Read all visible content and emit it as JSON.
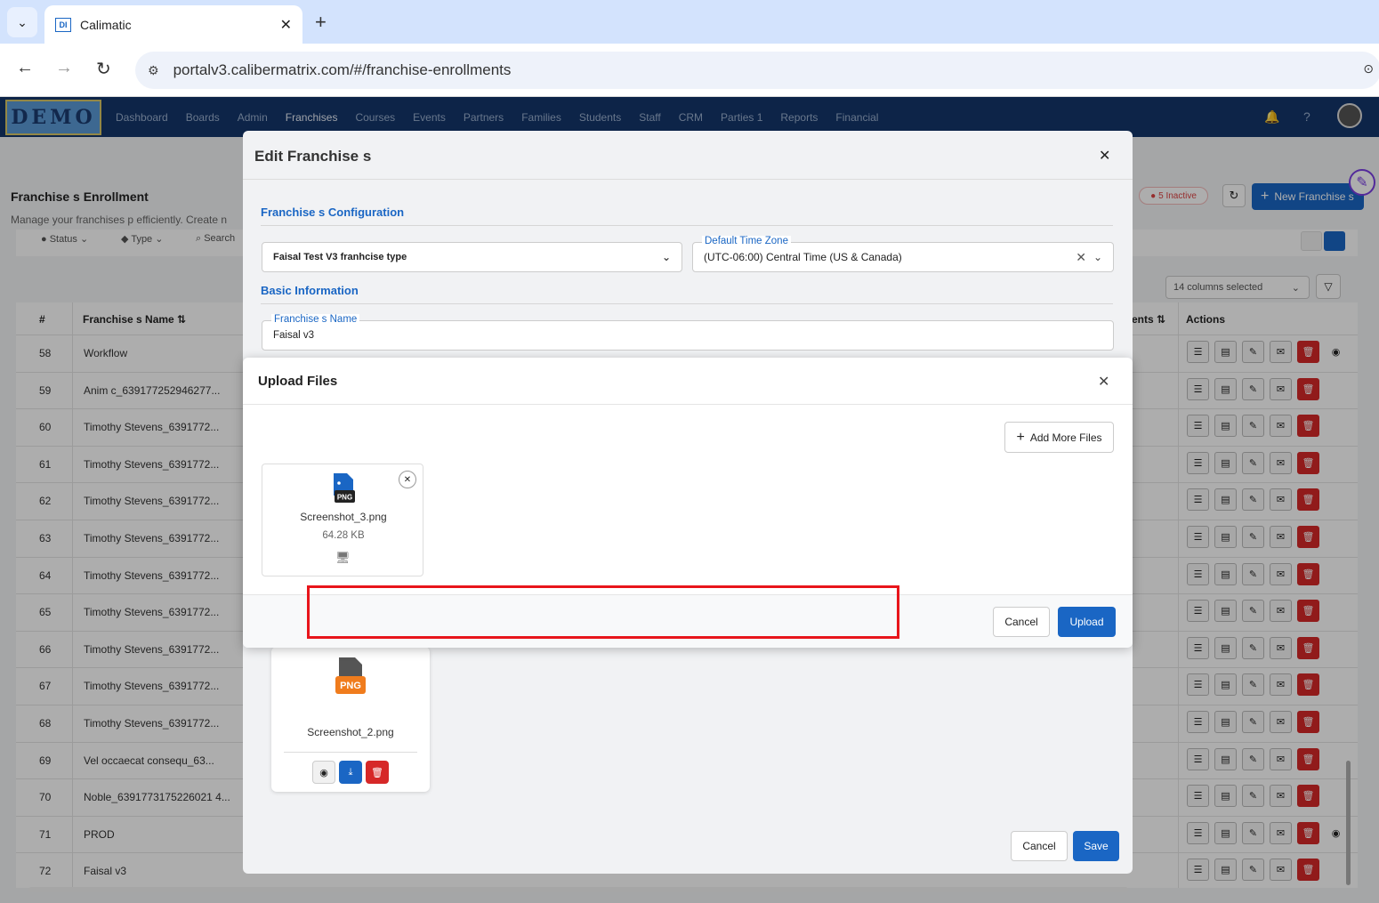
{
  "browser": {
    "tab_title": "Calimatic",
    "url": "portalv3.calibermatrix.com/#/franchise-enrollments"
  },
  "app": {
    "logo": "DEMO",
    "nav": [
      "Dashboard",
      "Boards",
      "Admin",
      "Franchises",
      "Courses",
      "Events",
      "Partners",
      "Families",
      "Students",
      "Staff",
      "CRM",
      "Parties 1",
      "Reports",
      "Financial"
    ],
    "active_nav": "Franchises"
  },
  "page": {
    "title": "Franchise s Enrollment",
    "subtitle": "Manage your franchises p efficiently. Create n",
    "filters": {
      "status": "Status",
      "type": "Type",
      "search": "Search"
    },
    "inactive_badge": "5 Inactive",
    "new_button": "New Franchise s",
    "columns_selected": "14 columns selected",
    "table": {
      "headers": {
        "num": "#",
        "name": "Franchise s Name",
        "ents": "ents",
        "actions": "Actions"
      },
      "rows": [
        {
          "num": "58",
          "name": "Workflow"
        },
        {
          "num": "59",
          "name": "Anim c_639177252946277..."
        },
        {
          "num": "60",
          "name": "Timothy Stevens_6391772..."
        },
        {
          "num": "61",
          "name": "Timothy Stevens_6391772..."
        },
        {
          "num": "62",
          "name": "Timothy Stevens_6391772..."
        },
        {
          "num": "63",
          "name": "Timothy Stevens_6391772..."
        },
        {
          "num": "64",
          "name": "Timothy Stevens_6391772..."
        },
        {
          "num": "65",
          "name": "Timothy Stevens_6391772..."
        },
        {
          "num": "66",
          "name": "Timothy Stevens_6391772..."
        },
        {
          "num": "67",
          "name": "Timothy Stevens_6391772..."
        },
        {
          "num": "68",
          "name": "Timothy Stevens_6391772..."
        },
        {
          "num": "69",
          "name": "Vel occaecat consequ_63..."
        },
        {
          "num": "70",
          "name": "Noble_6391773175226021 4..."
        },
        {
          "num": "71",
          "name": "PROD"
        },
        {
          "num": "72",
          "name": "Faisal v3"
        }
      ]
    }
  },
  "edit_modal": {
    "title": "Edit Franchise s",
    "config_section": "Franchise s Configuration",
    "franchise_type": "Faisal Test V3 franhcise type",
    "timezone_label": "Default Time Zone",
    "timezone_value": "(UTC-06:00) Central Time (US & Canada)",
    "basic_section": "Basic Information",
    "name_label": "Franchise s Name",
    "name_value": "Faisal v3",
    "existing_file": {
      "name": "Screenshot_2.png",
      "ext": "PNG"
    },
    "cancel": "Cancel",
    "save": "Save"
  },
  "upload_modal": {
    "title": "Upload Files",
    "add_more": "Add More Files",
    "file": {
      "name": "Screenshot_3.png",
      "size": "64.28 KB",
      "ext": "PNG"
    },
    "cancel": "Cancel",
    "upload": "Upload"
  }
}
